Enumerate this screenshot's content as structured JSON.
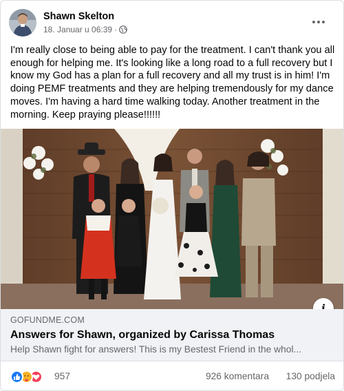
{
  "post": {
    "author": "Shawn Skelton",
    "timestamp": "18. Januar u 06:39 ·",
    "privacy_icon": "globe-icon",
    "more_icon": "ellipsis-icon",
    "text": "I'm really close to being able to pay for the treatment. I can't thank you all enough for helping me. It's looking like a long road to a full recovery but I know my God has a plan for a full recovery and all my trust is in him! I'm doing PEMF treatments and they are helping tremendously for my dance moves. I'm having a hard time walking today. Another treatment in the morning. Keep praying please!!!!!!"
  },
  "link_preview": {
    "domain": "GOFUNDME.COM",
    "title": "Answers for Shawn, organized by Carissa Thomas",
    "description": "Help Shawn fight for answers! This is my Bestest Friend in the whol...",
    "info_icon": "info-icon"
  },
  "footer": {
    "reaction_icons": [
      "like-icon",
      "care-icon",
      "love-icon"
    ],
    "reaction_count": "957",
    "comments": "926 komentara",
    "shares": "130 podjela"
  },
  "colors": {
    "accent": "#1877f2",
    "text": "#050505",
    "secondary": "#65676b",
    "link_bg": "#f0f2f5"
  }
}
